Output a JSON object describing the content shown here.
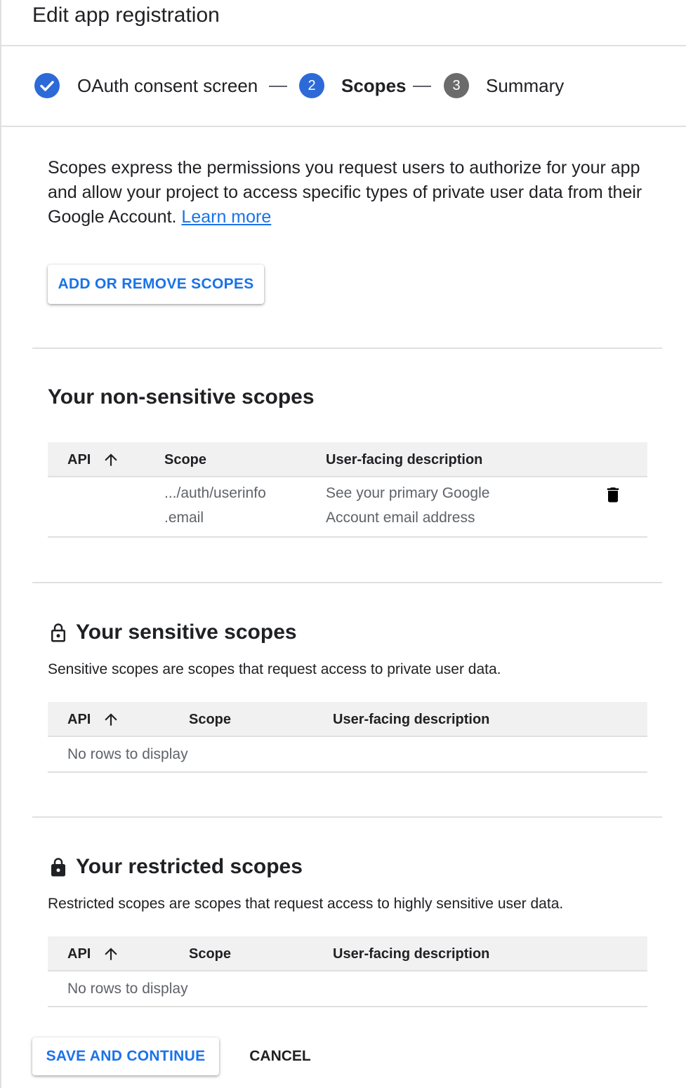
{
  "header": {
    "title": "Edit app registration"
  },
  "stepper": {
    "steps": [
      {
        "number": "",
        "label": "OAuth consent screen",
        "state": "completed"
      },
      {
        "number": "2",
        "label": "Scopes",
        "state": "active"
      },
      {
        "number": "3",
        "label": "Summary",
        "state": "pending"
      }
    ]
  },
  "intro": {
    "text": "Scopes express the permissions you request users to authorize for your app and allow your project to access specific types of private user data from their Google Account.",
    "link": "Learn more"
  },
  "add_scopes_button": "ADD OR REMOVE SCOPES",
  "non_sensitive": {
    "title": "Your non-sensitive scopes",
    "columns": {
      "api": "API",
      "scope": "Scope",
      "description": "User-facing description"
    },
    "rows": [
      {
        "api": "",
        "scope_line1": ".../auth/userinfo",
        "scope_line2": ".email",
        "desc_line1": "See your primary Google",
        "desc_line2": "Account email address"
      }
    ]
  },
  "sensitive": {
    "title": "Your sensitive scopes",
    "description": "Sensitive scopes are scopes that request access to private user data.",
    "columns": {
      "api": "API",
      "scope": "Scope",
      "description": "User-facing description"
    },
    "empty": "No rows to display"
  },
  "restricted": {
    "title": "Your restricted scopes",
    "description": "Restricted scopes are scopes that request access to highly sensitive user data.",
    "columns": {
      "api": "API",
      "scope": "Scope",
      "description": "User-facing description"
    },
    "empty": "No rows to display"
  },
  "footer": {
    "save_label": "SAVE AND CONTINUE",
    "cancel_label": "CANCEL"
  },
  "colors": {
    "accent": "#1a73e8",
    "active_step": "#2d6ad7",
    "pending_step": "#6b6b6b"
  },
  "icons": [
    "check-icon",
    "arrow-up-icon",
    "delete-icon",
    "lock-open-icon",
    "lock-icon"
  ]
}
